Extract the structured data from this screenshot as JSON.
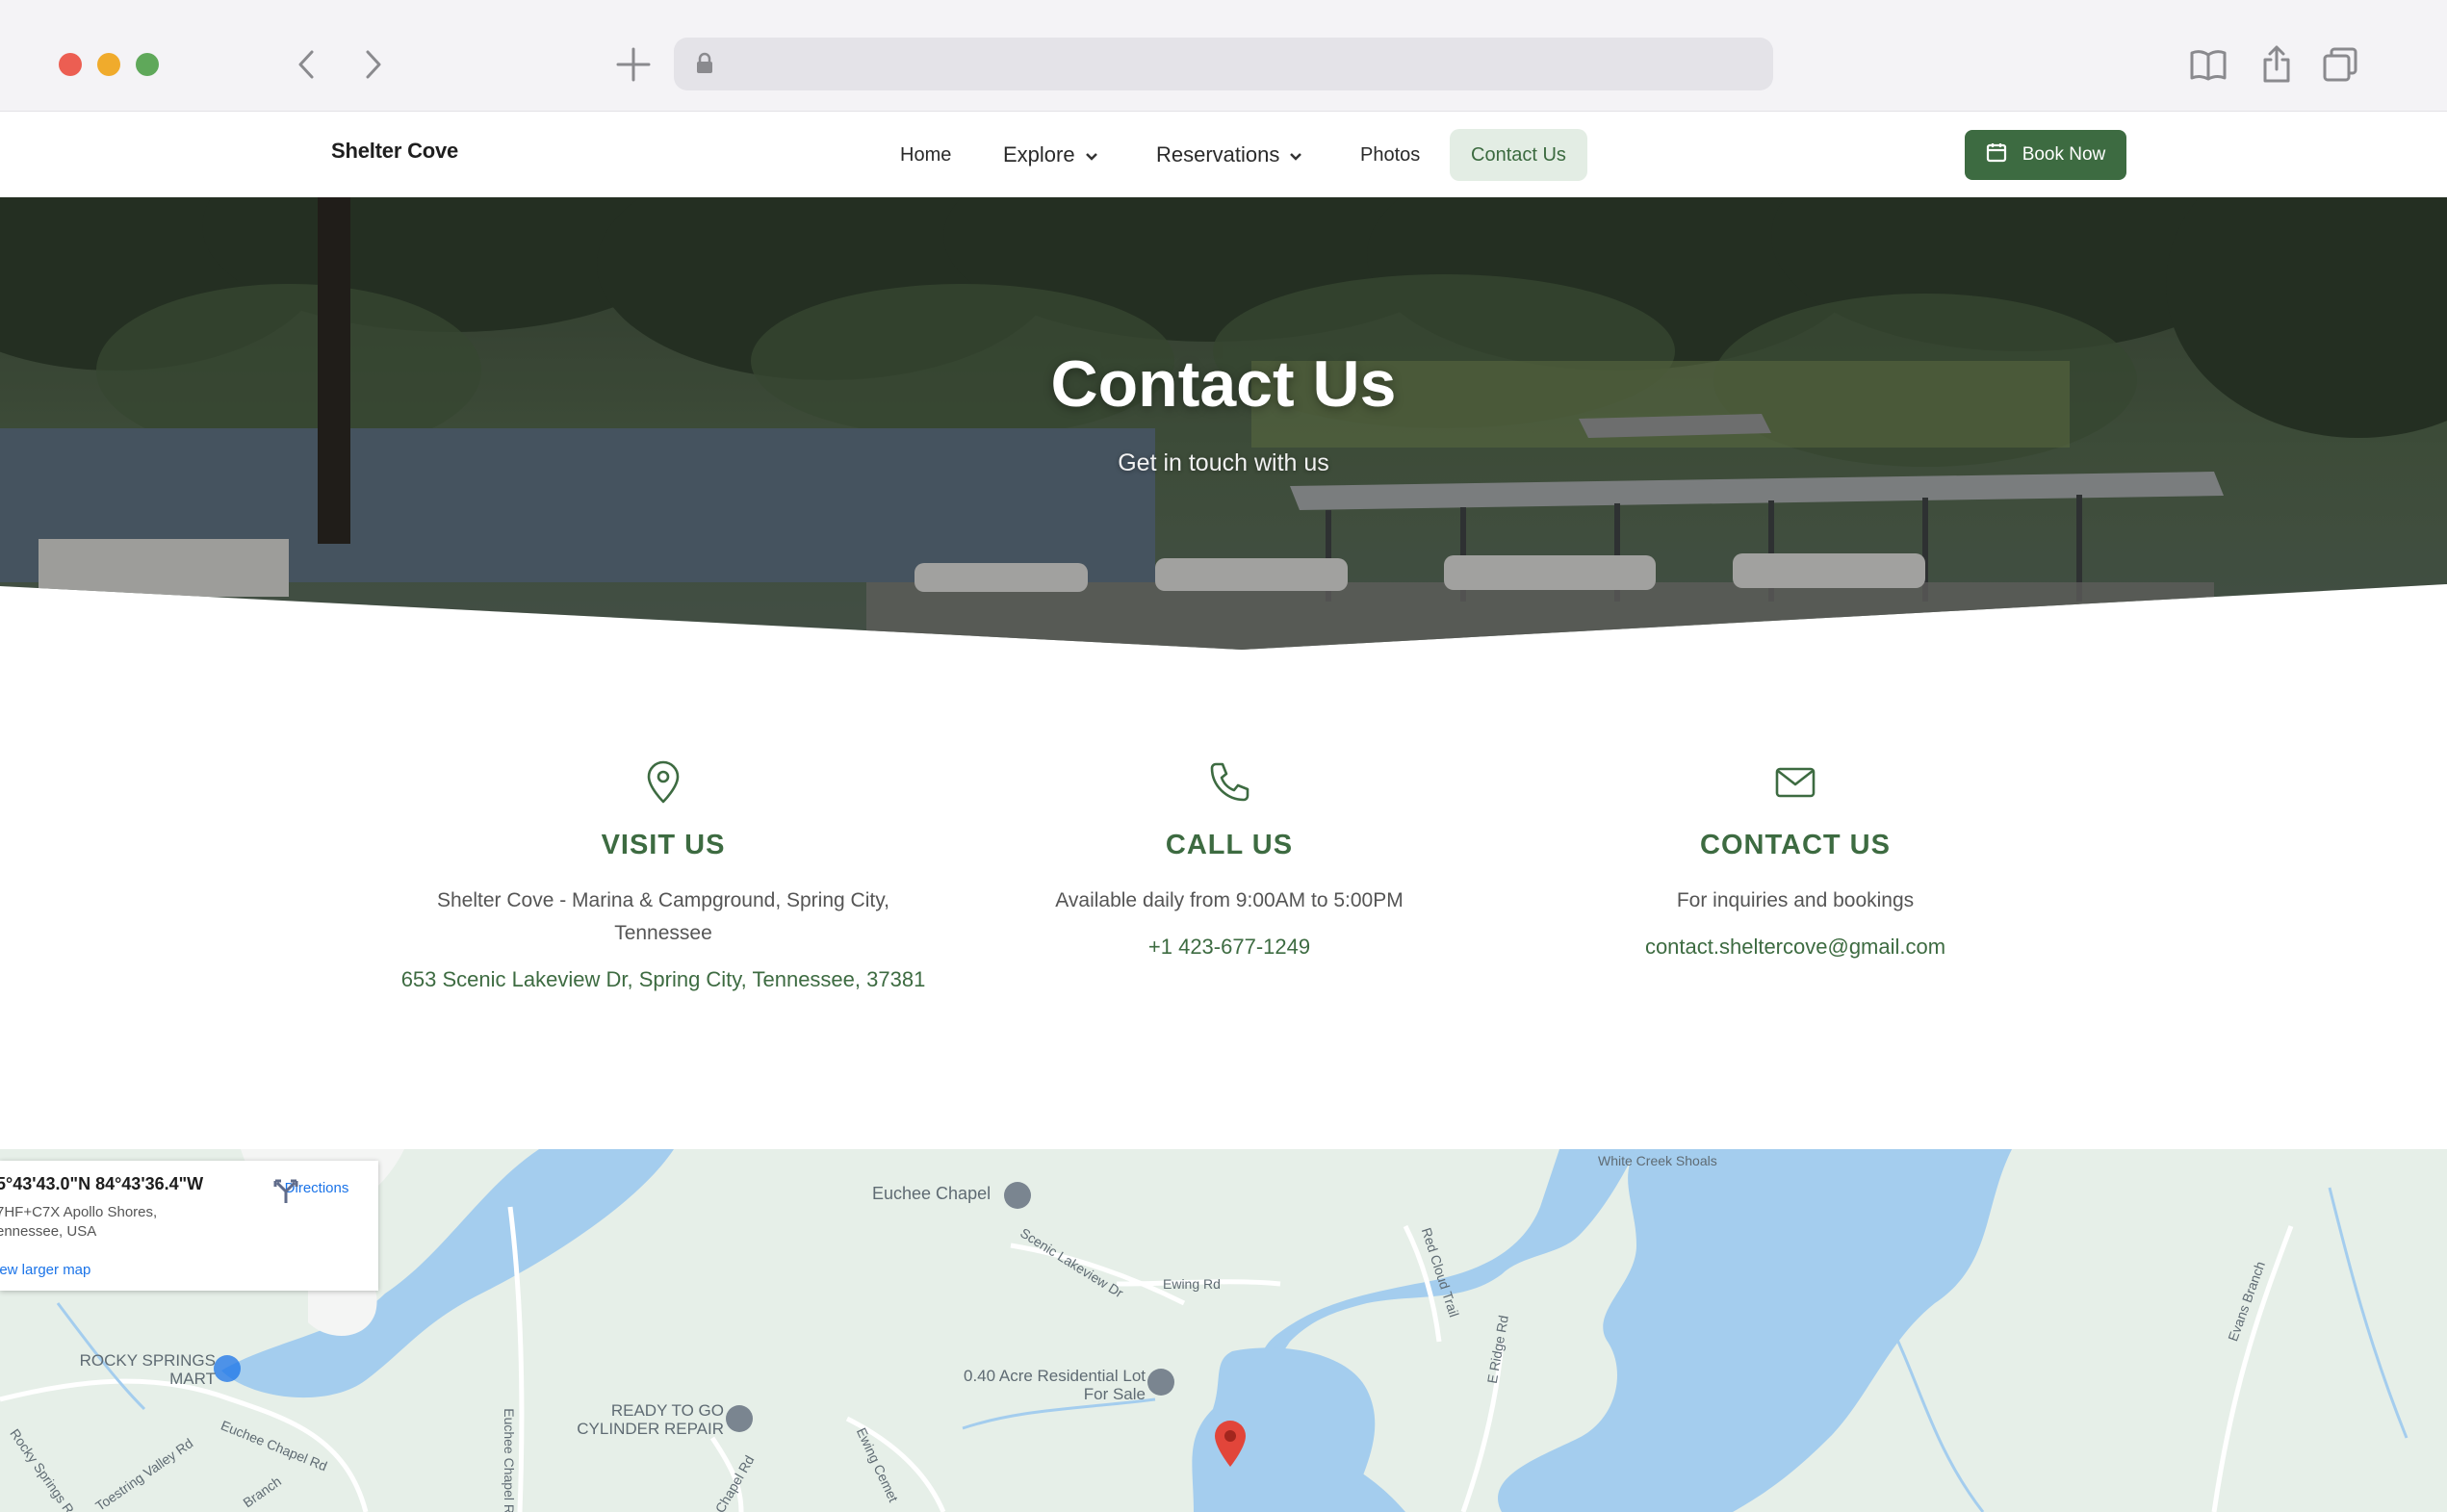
{
  "browser": {
    "icons": [
      "back-icon",
      "forward-icon",
      "new-tab-icon",
      "lock-icon",
      "reader-icon",
      "share-icon",
      "tabs-icon"
    ]
  },
  "nav": {
    "brand": "Shelter Cove",
    "items": [
      {
        "label": "Home"
      },
      {
        "label": "Explore"
      },
      {
        "label": "Reservations"
      },
      {
        "label": "Photos"
      },
      {
        "label": "Contact Us"
      }
    ],
    "active": "Contact Us",
    "book_label": "Book Now"
  },
  "hero": {
    "title": "Contact Us",
    "subtitle": "Get in touch with us"
  },
  "contact": {
    "visit": {
      "heading": "VISIT US",
      "desc": "Shelter Cove - Marina & Campground, Spring City, Tennessee",
      "link": "653 Scenic Lakeview Dr, Spring City, Tennessee, 37381"
    },
    "call": {
      "heading": "CALL US",
      "desc": "Available daily from 9:00AM to 5:00PM",
      "link": "+1 423-677-1249"
    },
    "email": {
      "heading": "CONTACT US",
      "desc": "For inquiries and bookings",
      "link": "contact.sheltercove@gmail.com"
    }
  },
  "map": {
    "card": {
      "coords": "5°43'43.0\"N 84°43'36.4\"W",
      "address": "7HF+C7X Apollo Shores, ennessee, USA",
      "larger_map": "iew larger map",
      "directions": "Directions"
    },
    "labels": {
      "white_creek": "White Creek Shoals",
      "euchee_chapel": "Euchee Chapel",
      "scenic_lakeview": "Scenic Lakeview Dr",
      "ewing_rd": "Ewing Rd",
      "red_cloud": "Red Cloud Trail",
      "ridge_rd": "E Ridge Rd",
      "evans_branch": "Evans Branch",
      "rocky_springs_mart": "ROCKY SPRINGS MART",
      "euchee_chapel_rd": "Euchee Chapel Rd",
      "euchee_chapel_rd2": "Euchee Chapel Rd",
      "ready_to_go": "READY TO GO CYLINDER REPAIR",
      "acre_lot": "0.40 Acre Residential Lot For Sale",
      "chapel_rd": "Chapel Rd",
      "ewing_cemetery": "Ewing Cemet",
      "rocky_springs_rd": "Rocky Springs Rd",
      "toestring_valley": "Toestring Valley Rd",
      "branch": "Branch"
    },
    "colors": {
      "land": "#e6efe8",
      "water": "#a4cdee",
      "marker": "#e2453a"
    }
  },
  "colors": {
    "brand_green": "#3d6b41",
    "active_bg": "#e3ede4"
  }
}
